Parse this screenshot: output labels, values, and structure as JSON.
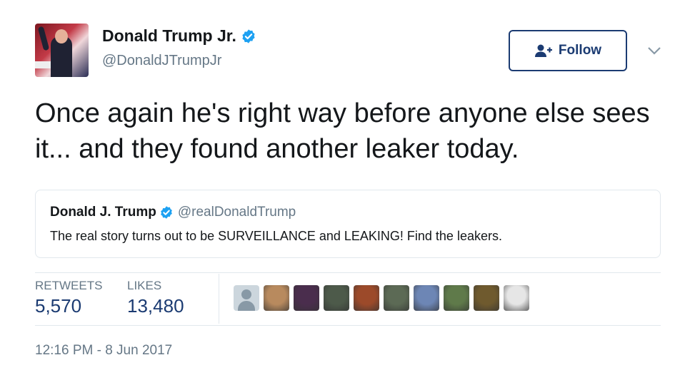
{
  "author": {
    "name": "Donald Trump Jr.",
    "handle": "@DonaldJTrumpJr",
    "verified_icon": "verified-badge-icon",
    "avatar_icon": "profile-photo"
  },
  "follow_button": {
    "label": "Follow",
    "icon": "add-user-icon",
    "color": "#1b3b72"
  },
  "menu_icon": "chevron-down-icon",
  "tweet": {
    "text": "Once again he's right way before anyone else sees it... and they found another leaker today."
  },
  "quoted_tweet": {
    "name": "Donald J. Trump",
    "handle": "@realDonaldTrump",
    "text": "The real story turns out to be SURVEILLANCE and LEAKING! Find the leakers."
  },
  "stats": {
    "retweets_label": "RETWEETS",
    "retweets_value": "5,570",
    "likes_label": "LIKES",
    "likes_value": "13,480"
  },
  "likers": [
    {
      "type": "default-avatar",
      "color": "#ccd6dd"
    },
    {
      "type": "photo",
      "color": "#b88a5e"
    },
    {
      "type": "photo",
      "color": "#4a2d4d"
    },
    {
      "type": "photo",
      "color": "#4d5a4a"
    },
    {
      "type": "photo",
      "color": "#9c4a2a"
    },
    {
      "type": "photo",
      "color": "#5c6a55"
    },
    {
      "type": "photo",
      "color": "#6d86b5"
    },
    {
      "type": "photo",
      "color": "#5f7a4a"
    },
    {
      "type": "photo",
      "color": "#6f5a2e"
    },
    {
      "type": "photo",
      "color": "#e6e6e6"
    }
  ],
  "timestamp": "12:16 PM - 8 Jun 2017",
  "colors": {
    "text": "#14171a",
    "muted": "#657786",
    "verified": "#1da1f2",
    "border": "#e1e8ed",
    "stat_value": "#1b3b72"
  }
}
